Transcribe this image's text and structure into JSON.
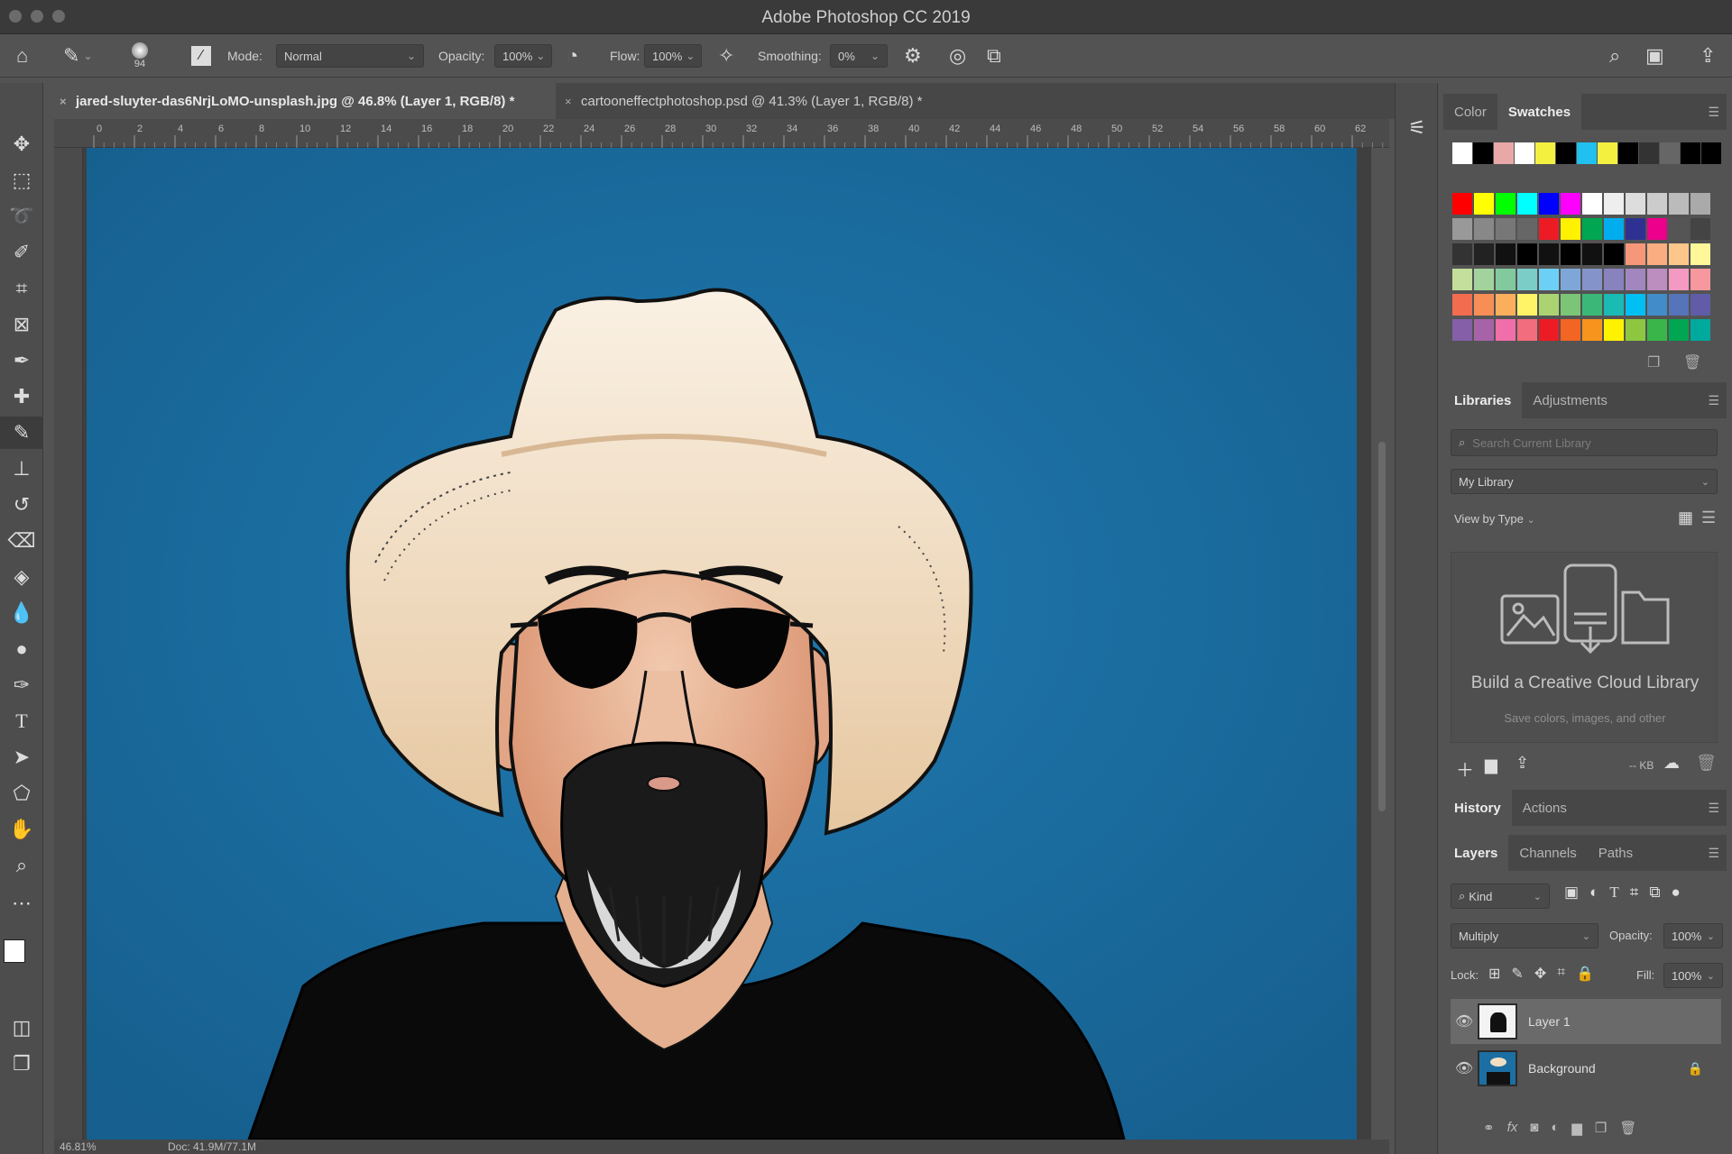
{
  "window": {
    "title": "Adobe Photoshop CC 2019"
  },
  "options": {
    "brush_size": "94",
    "mode_label": "Mode:",
    "mode_value": "Normal",
    "opacity_label": "Opacity:",
    "opacity_value": "100%",
    "flow_label": "Flow:",
    "flow_value": "100%",
    "smoothing_label": "Smoothing:",
    "smoothing_value": "0%"
  },
  "tabs": [
    {
      "label": "jared-sluyter-das6NrjLoMO-unsplash.jpg @ 46.8% (Layer 1, RGB/8) *",
      "active": true
    },
    {
      "label": "cartooneffectphotoshop.psd @ 41.3% (Layer 1, RGB/8) *",
      "active": false
    }
  ],
  "ruler": {
    "ticks": [
      "0",
      "2",
      "4",
      "6",
      "8",
      "10",
      "12",
      "14",
      "16",
      "18",
      "20",
      "22",
      "24",
      "26",
      "28",
      "30",
      "32",
      "34",
      "36",
      "38",
      "40",
      "42",
      "44",
      "46",
      "48",
      "50",
      "52",
      "54",
      "56",
      "58",
      "60",
      "62"
    ]
  },
  "status": {
    "zoom": "46.81%",
    "doc": "Doc: 41.9M/77.1M"
  },
  "swatches_panel": {
    "tabs": [
      "Color",
      "Swatches"
    ],
    "active_tab": "Swatches",
    "recent": [
      "#ffffff",
      "#000000",
      "#e8a8a8",
      "#ffffff",
      "#f4f040",
      "#000000",
      "#20c0f0",
      "#f4f040",
      "#000000",
      "#333333",
      "#666666",
      "#000000",
      "#000000"
    ],
    "grid": [
      [
        "#ff0000",
        "#ffff00",
        "#00ff00",
        "#00ffff",
        "#0000ff",
        "#ff00ff",
        "#ffffff",
        "#eeeeee",
        "#dddddd",
        "#cccccc",
        "#bbbbbb",
        "#aaaaaa"
      ],
      [
        "#999999",
        "#888888",
        "#777777",
        "#666666",
        "#ed1c24",
        "#fff200",
        "#00a651",
        "#00aeef",
        "#2e3192",
        "#ec008c",
        "#555555",
        "#444444"
      ],
      [
        "#333333",
        "#222222",
        "#111111",
        "#000000",
        "#111111",
        "#000000",
        "#111111",
        "#000000",
        "#f7977a",
        "#f9ad81",
        "#fdc68a",
        "#fff79a"
      ],
      [
        "#c4df9b",
        "#a3d39c",
        "#82ca9d",
        "#7bcdc8",
        "#6ecff6",
        "#7ea7d8",
        "#8493ca",
        "#8882be",
        "#a187be",
        "#bc8dbf",
        "#f49ac2",
        "#f6989d"
      ],
      [
        "#f26c4f",
        "#f68e55",
        "#fbaf5c",
        "#fff467",
        "#acd372",
        "#7cc576",
        "#3bb878",
        "#1abbb4",
        "#00bff3",
        "#438cca",
        "#5574b9",
        "#605ca8"
      ],
      [
        "#855fa8",
        "#a763a8",
        "#f06ea9",
        "#f26d7d",
        "#ed1c24",
        "#f26522",
        "#f7941d",
        "#fff200",
        "#8dc73f",
        "#39b54a",
        "#00a651",
        "#00a99d"
      ]
    ]
  },
  "libraries_panel": {
    "tabs": [
      "Libraries",
      "Adjustments"
    ],
    "active_tab": "Libraries",
    "search_placeholder": "Search Current Library",
    "library_select": "My Library",
    "view_by": "View by Type",
    "empty_title": "Build a Creative Cloud Library",
    "empty_sub": "Save colors, images, and other",
    "storage": "-- KB"
  },
  "history_panel": {
    "tabs": [
      "History",
      "Actions"
    ],
    "active_tab": "History"
  },
  "layers_panel": {
    "tabs": [
      "Layers",
      "Channels",
      "Paths"
    ],
    "active_tab": "Layers",
    "filter": "Kind",
    "blend_mode": "Multiply",
    "opacity_label": "Opacity:",
    "opacity_value": "100%",
    "lock_label": "Lock:",
    "fill_label": "Fill:",
    "fill_value": "100%",
    "layers": [
      {
        "name": "Layer 1",
        "selected": true
      },
      {
        "name": "Background",
        "selected": false,
        "locked": true
      }
    ]
  },
  "colors": {
    "canvas_bg": "#1b6fa3",
    "ui_dark": "#535353",
    "hat": "#f2dec2",
    "skin": "#e9b79a"
  }
}
